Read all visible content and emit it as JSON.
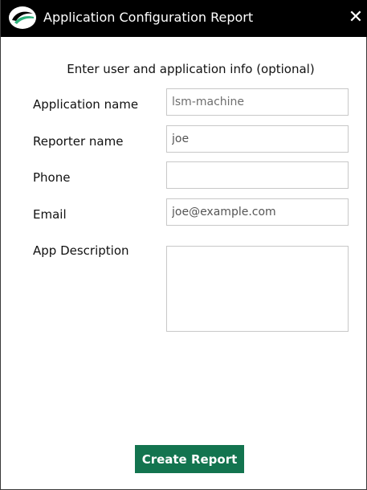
{
  "window": {
    "title": "Application Configuration Report",
    "close_glyph": "✕",
    "logo_icon": "app-logo-icon",
    "close_icon": "close-icon"
  },
  "form": {
    "intro": "Enter user and application info (optional)",
    "fields": {
      "application_name": {
        "label": "Application name",
        "value": "lsm-machine"
      },
      "reporter_name": {
        "label": "Reporter name",
        "value": "joe"
      },
      "phone": {
        "label": "Phone",
        "value": ""
      },
      "email": {
        "label": "Email",
        "value": "joe@example.com"
      },
      "app_description": {
        "label": "App Description",
        "value": ""
      }
    }
  },
  "actions": {
    "create_report_label": "Create Report"
  },
  "colors": {
    "titlebar_bg": "#000000",
    "button_bg": "#13744f",
    "logo_accent": "#2bb07a"
  }
}
